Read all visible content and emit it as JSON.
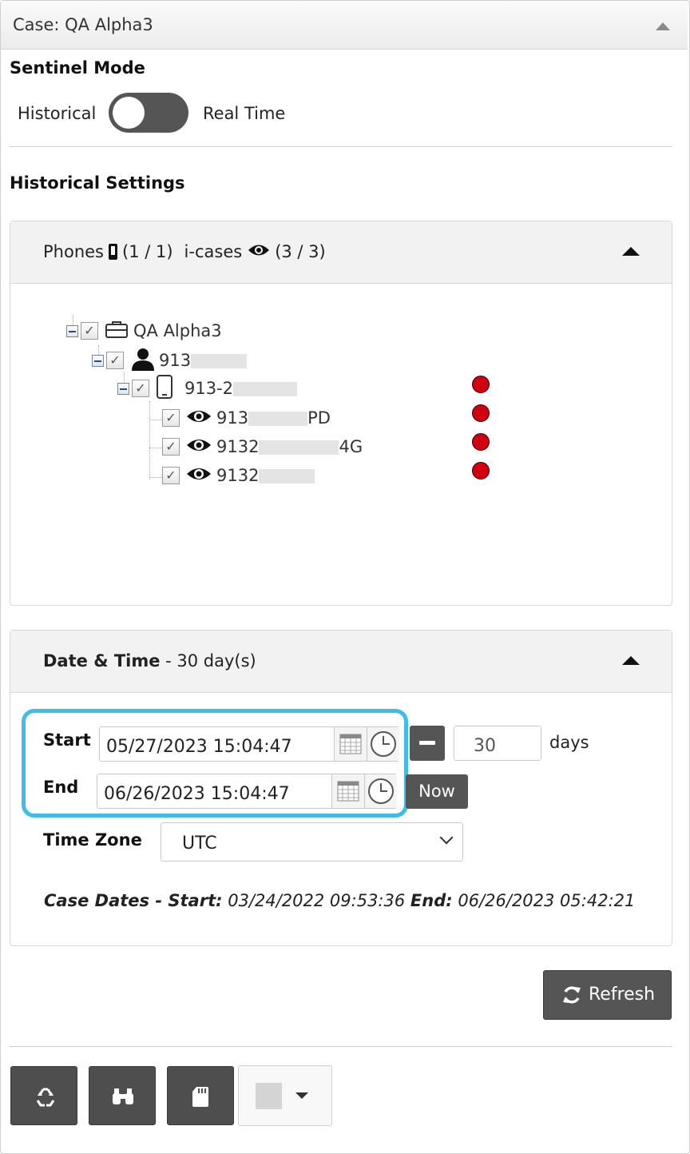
{
  "case": {
    "title": "Case: QA Alpha3"
  },
  "sentinel": {
    "heading": "Sentinel Mode",
    "left_label": "Historical",
    "right_label": "Real Time",
    "mode": "Historical"
  },
  "historical": {
    "heading": "Historical Settings"
  },
  "phones_panel": {
    "phones_label": "Phones",
    "phones_count": "(1 / 1)",
    "icases_label": "i-cases",
    "icases_count": "(3 / 3)"
  },
  "tree": {
    "root": {
      "label": "QA Alpha3",
      "icon": "briefcase-icon"
    },
    "person": {
      "label": "913",
      "icon": "person-icon"
    },
    "device": {
      "label": "913-2",
      "icon": "phone-icon",
      "status_color": "#d00010"
    },
    "icases": [
      {
        "label_start": "913",
        "label_end": "PD",
        "icon": "eye-icon",
        "status_color": "#d00010"
      },
      {
        "label_start": "9132",
        "label_end": "4G",
        "icon": "eye-icon",
        "status_color": "#d00010"
      },
      {
        "label_start": "9132",
        "label_end": "",
        "icon": "eye-icon",
        "status_color": "#d00010"
      }
    ]
  },
  "datetime_panel": {
    "title": "Date & Time",
    "summary": " - 30 day(s)",
    "start_label": "Start",
    "start_value": "05/27/2023 15:04:47",
    "end_label": "End",
    "end_value": "06/26/2023 15:04:47",
    "days_value": "30",
    "days_label": "days",
    "now_label": "Now",
    "timezone_label": "Time Zone",
    "timezone_value": "UTC",
    "case_dates": {
      "label": "Case Dates",
      "sep": " - ",
      "start_label": "Start:",
      "start_value": "03/24/2022 09:53:36",
      "end_label": "End:",
      "end_value": "06/26/2023 05:42:21"
    }
  },
  "refresh_label": "Refresh",
  "colors": {
    "highlight": "#3dbde8",
    "dark_button": "#555555",
    "status_red": "#d00010"
  }
}
